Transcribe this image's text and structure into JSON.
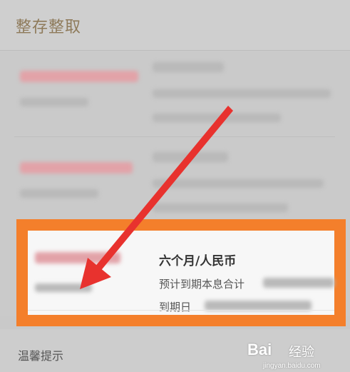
{
  "header": {
    "title": "整存整取"
  },
  "product": {
    "title": "六个月/人民币",
    "interest_label": "预计到期本息合计",
    "maturity_label": "到期日"
  },
  "footer": {
    "tip": "温馨提示"
  },
  "watermark": {
    "brand": "Bai",
    "sub": "经验",
    "url": "jingyan.baidu.com"
  },
  "colors": {
    "highlight": "#f47f2b",
    "arrow": "#e8322e",
    "title_gold": "#8e7a5a"
  }
}
